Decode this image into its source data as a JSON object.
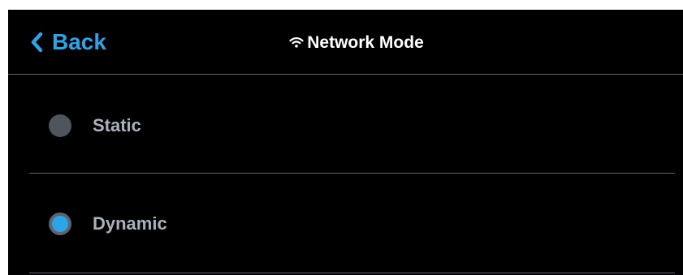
{
  "header": {
    "back_label": "Back",
    "title": "Network Mode",
    "title_icon": "wifi-icon",
    "back_icon": "chevron-left-icon"
  },
  "options": [
    {
      "label": "Static",
      "selected": false
    },
    {
      "label": "Dynamic",
      "selected": true
    }
  ],
  "colors": {
    "accent": "#2ea4e8",
    "background": "#000000",
    "divider": "#5c6470",
    "radio_off": "#4f555d",
    "label_text": "#a9b1bb",
    "title_text": "#ffffff"
  }
}
